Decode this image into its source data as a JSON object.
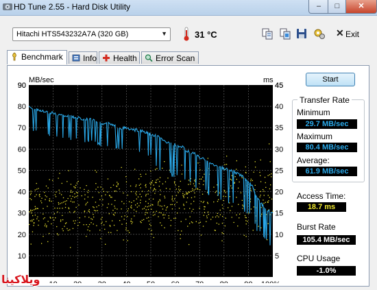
{
  "window": {
    "title": "HD Tune 2.55 - Hard Disk Utility",
    "minimize": "–",
    "maximize": "□",
    "close": "✕"
  },
  "toolbar": {
    "drive": "Hitachi HTS543232A7A (320 GB)",
    "temperature": "31 °C",
    "exit_label": "Exit",
    "icons": [
      "copy-text-icon",
      "copy-screenshot-icon",
      "save-icon",
      "options-icon",
      "exit-icon"
    ]
  },
  "tabs": [
    {
      "label": "Benchmark",
      "icon": "benchmark-icon",
      "active": true
    },
    {
      "label": "Info",
      "icon": "info-icon"
    },
    {
      "label": "Health",
      "icon": "health-icon"
    },
    {
      "label": "Error Scan",
      "icon": "error-scan-icon"
    }
  ],
  "benchmark": {
    "start_label": "Start",
    "transfer_rate_title": "Transfer Rate",
    "minimum_label": "Minimum",
    "minimum_value": "29.7 MB/sec",
    "maximum_label": "Maximum",
    "maximum_value": "80.4 MB/sec",
    "average_label": "Average:",
    "average_value": "61.9 MB/sec",
    "access_time_label": "Access Time:",
    "access_time_value": "18.7 ms",
    "burst_rate_label": "Burst Rate",
    "burst_rate_value": "105.4 MB/sec",
    "cpu_usage_label": "CPU Usage",
    "cpu_usage_value": "-1.0%"
  },
  "watermark": "ويلاكينا",
  "colors": {
    "plot_background": "#000000",
    "grid": "#6f6f6f",
    "transfer_line": "#2aa8e8",
    "access_points": "#f0e830",
    "accent_blue": "#2aa8e8"
  },
  "chart_data": {
    "type": "line",
    "title": "",
    "y_left_label": "MB/sec",
    "y_right_label": "ms",
    "y_left_ticks": [
      "10",
      "20",
      "30",
      "40",
      "50",
      "60",
      "70",
      "80",
      "90"
    ],
    "y_right_ticks": [
      "5",
      "10",
      "15",
      "20",
      "25",
      "30",
      "35",
      "40",
      "45"
    ],
    "x_ticks": [
      "10",
      "20",
      "30",
      "40",
      "50",
      "60",
      "70",
      "80",
      "90",
      "100%"
    ],
    "xlim": [
      0,
      100
    ],
    "ylim_left": [
      0,
      90
    ],
    "ylim_right": [
      0,
      45
    ],
    "grid": true,
    "series": [
      {
        "name": "",
        "axis": "left",
        "style": "line",
        "x": [
          0,
          3,
          5,
          8,
          10,
          13,
          15,
          18,
          20,
          23,
          25,
          28,
          30,
          33,
          35,
          38,
          40,
          43,
          45,
          48,
          50,
          53,
          55,
          58,
          60,
          63,
          65,
          68,
          70,
          73,
          75,
          78,
          80,
          83,
          85,
          88,
          90,
          92,
          93,
          95,
          97,
          100
        ],
        "values": [
          80,
          79,
          78,
          77,
          77,
          76,
          76,
          75,
          75,
          74,
          74,
          73,
          72,
          72,
          71,
          70,
          70,
          69,
          69,
          68,
          67,
          66,
          64,
          63,
          62,
          61,
          59,
          58,
          56,
          55,
          53,
          52,
          51,
          50,
          49,
          47,
          45,
          42,
          38,
          35,
          32,
          30
        ]
      },
      {
        "name": "",
        "axis": "right",
        "style": "scatter",
        "description_free": true,
        "x_range": [
          0,
          100
        ],
        "y_range_ms": [
          6,
          33
        ],
        "mean_ms": 18.7
      }
    ]
  }
}
